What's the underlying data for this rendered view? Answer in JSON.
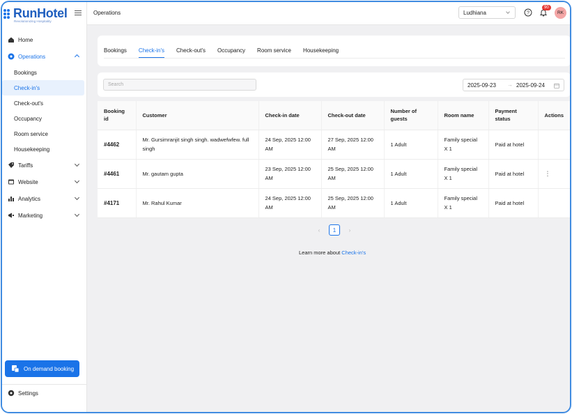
{
  "brand": {
    "name": "RunHotel",
    "tagline": "Revolutionizing Hospitality",
    "color": "#1a73e8"
  },
  "sidebar": {
    "items": [
      {
        "label": "Home",
        "icon": "home-icon"
      },
      {
        "label": "Operations",
        "icon": "operations-icon",
        "expanded": true
      },
      {
        "label": "Tariffs",
        "icon": "tariffs-icon"
      },
      {
        "label": "Website",
        "icon": "website-icon"
      },
      {
        "label": "Analytics",
        "icon": "analytics-icon"
      },
      {
        "label": "Marketing",
        "icon": "marketing-icon"
      }
    ],
    "sub_items": [
      "Bookings",
      "Check-in's",
      "Check-out's",
      "Occupancy",
      "Room service",
      "Housekeeping"
    ],
    "active_sub": "Check-in's",
    "demand_button": "On demand booking",
    "settings": "Settings"
  },
  "topbar": {
    "title": "Operations",
    "city": "Ludhiana",
    "notification_count": "90",
    "avatar_initials": "RK"
  },
  "tabs": [
    "Bookings",
    "Check-in's",
    "Check-out's",
    "Occupancy",
    "Room service",
    "Housekeeping"
  ],
  "active_tab": "Check-in's",
  "filters": {
    "search_placeholder": "Search",
    "date_from": "2025-09-23",
    "date_arrow": "→",
    "date_to": "2025-09-24"
  },
  "table": {
    "headers": [
      "Booking id",
      "Customer",
      "Check-in date",
      "Check-out date",
      "Number of guests",
      "Room name",
      "Payment status",
      "Actions"
    ],
    "rows": [
      {
        "id": "#4462",
        "customer": "Mr. Gursimranjit singh singh. wadwefwfew. full singh",
        "checkin": "24 Sep, 2025 12:00 AM",
        "checkout": "27 Sep, 2025 12:00 AM",
        "guests": "1 Adult",
        "room": "Family special X 1",
        "payment": "Paid at hotel",
        "actions": ""
      },
      {
        "id": "#4461",
        "customer": "Mr. gautam gupta",
        "checkin": "23 Sep, 2025 12:00 AM",
        "checkout": "25 Sep, 2025 12:00 AM",
        "guests": "1 Adult",
        "room": "Family special X 1",
        "payment": "Paid at hotel",
        "actions": "⋮"
      },
      {
        "id": "#4171",
        "customer": "Mr. Rahul Kumar",
        "checkin": "24 Sep, 2025 12:00 AM",
        "checkout": "25 Sep, 2025 12:00 AM",
        "guests": "1 Adult",
        "room": "Family special X 1",
        "payment": "Paid at hotel",
        "actions": ""
      }
    ]
  },
  "pagination": {
    "prev": "‹",
    "current": "1",
    "next": "›"
  },
  "footer": {
    "learn_text": "Learn more about ",
    "learn_link": "Check-in's"
  }
}
